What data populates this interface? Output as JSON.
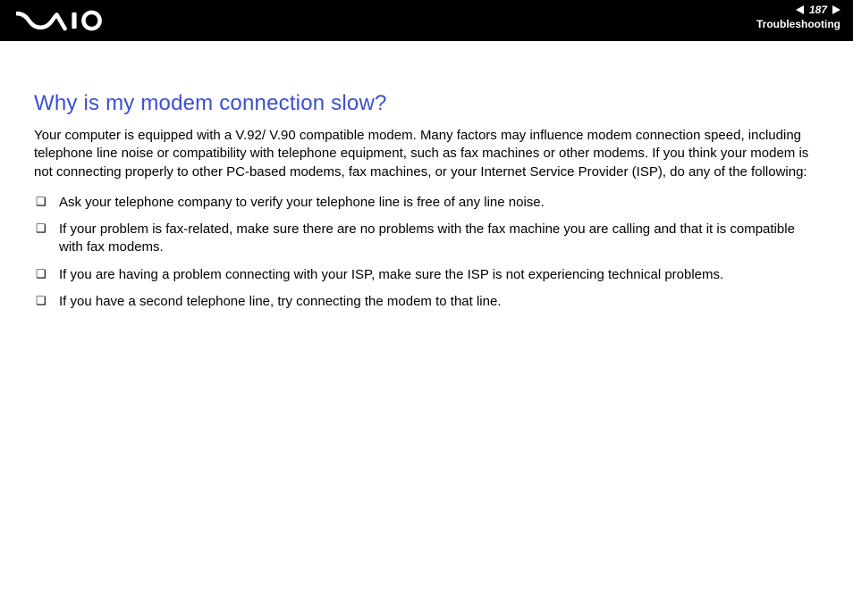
{
  "header": {
    "page_number": "187",
    "breadcrumb": "Troubleshooting"
  },
  "content": {
    "heading": "Why is my modem connection slow?",
    "intro": "Your computer is equipped with a V.92/ V.90 compatible modem. Many factors may influence modem connection speed, including telephone line noise or compatibility with telephone equipment, such as fax machines or other modems. If you think your modem is not connecting properly to other PC-based modems, fax machines, or your Internet Service Provider (ISP), do any of the following:",
    "bullets": [
      "Ask your telephone company to verify your telephone line is free of any line noise.",
      "If your problem is fax-related, make sure there are no problems with the fax machine you are calling and that it is compatible with fax modems.",
      "If you are having a problem connecting with your ISP, make sure the ISP is not experiencing technical problems.",
      "If you have a second telephone line, try connecting the modem to that line."
    ]
  }
}
